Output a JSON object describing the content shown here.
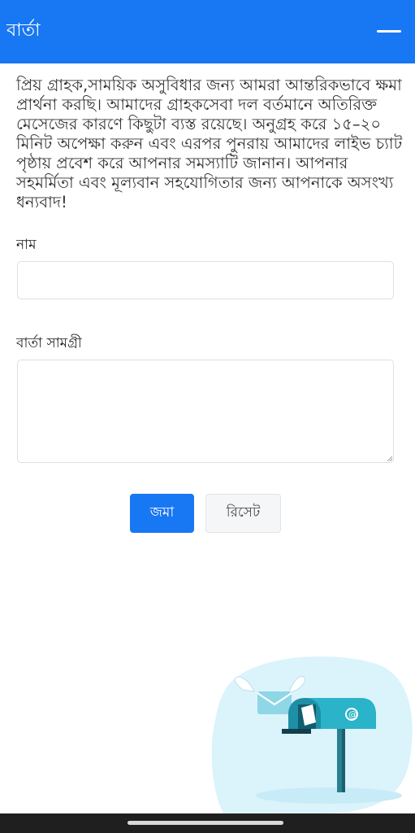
{
  "header": {
    "title": "বার্তা"
  },
  "notice": {
    "text": "প্রিয় গ্রাহক,সাময়িক অসুবিধার জন্য আমরা আন্তরিকভাবে ক্ষমা প্রার্থনা করছি। আমাদের গ্রাহকসেবা দল বর্তমানে অতিরিক্ত মেসেজের কারণে কিছুটা ব্যস্ত রয়েছে। অনুগ্রহ করে ১৫–২০ মিনিট অপেক্ষা করুন এবং এরপর পুনরায় আমাদের লাইভ চ্যাট পৃষ্ঠায় প্রবেশ করে আপনার সমস্যাটি জানান। আপনার সহমর্মিতা এবং মূল্যবান সহযোগিতার জন্য আপনাকে অসংখ্য ধন্যবাদ!"
  },
  "form": {
    "name_label": "নাম",
    "name_value": "",
    "message_label": "বার্তা সামগ্রী",
    "message_value": "",
    "submit_label": "জমা",
    "reset_label": "রিসেট"
  },
  "icons": {
    "menu": "menu-icon",
    "illustration": "mailbox-illustration"
  },
  "colors": {
    "header_bg": "#1877f2",
    "primary_button": "#1877f2",
    "secondary_button": "#f4f6f8",
    "illustration_accent": "#2ab3c9"
  }
}
